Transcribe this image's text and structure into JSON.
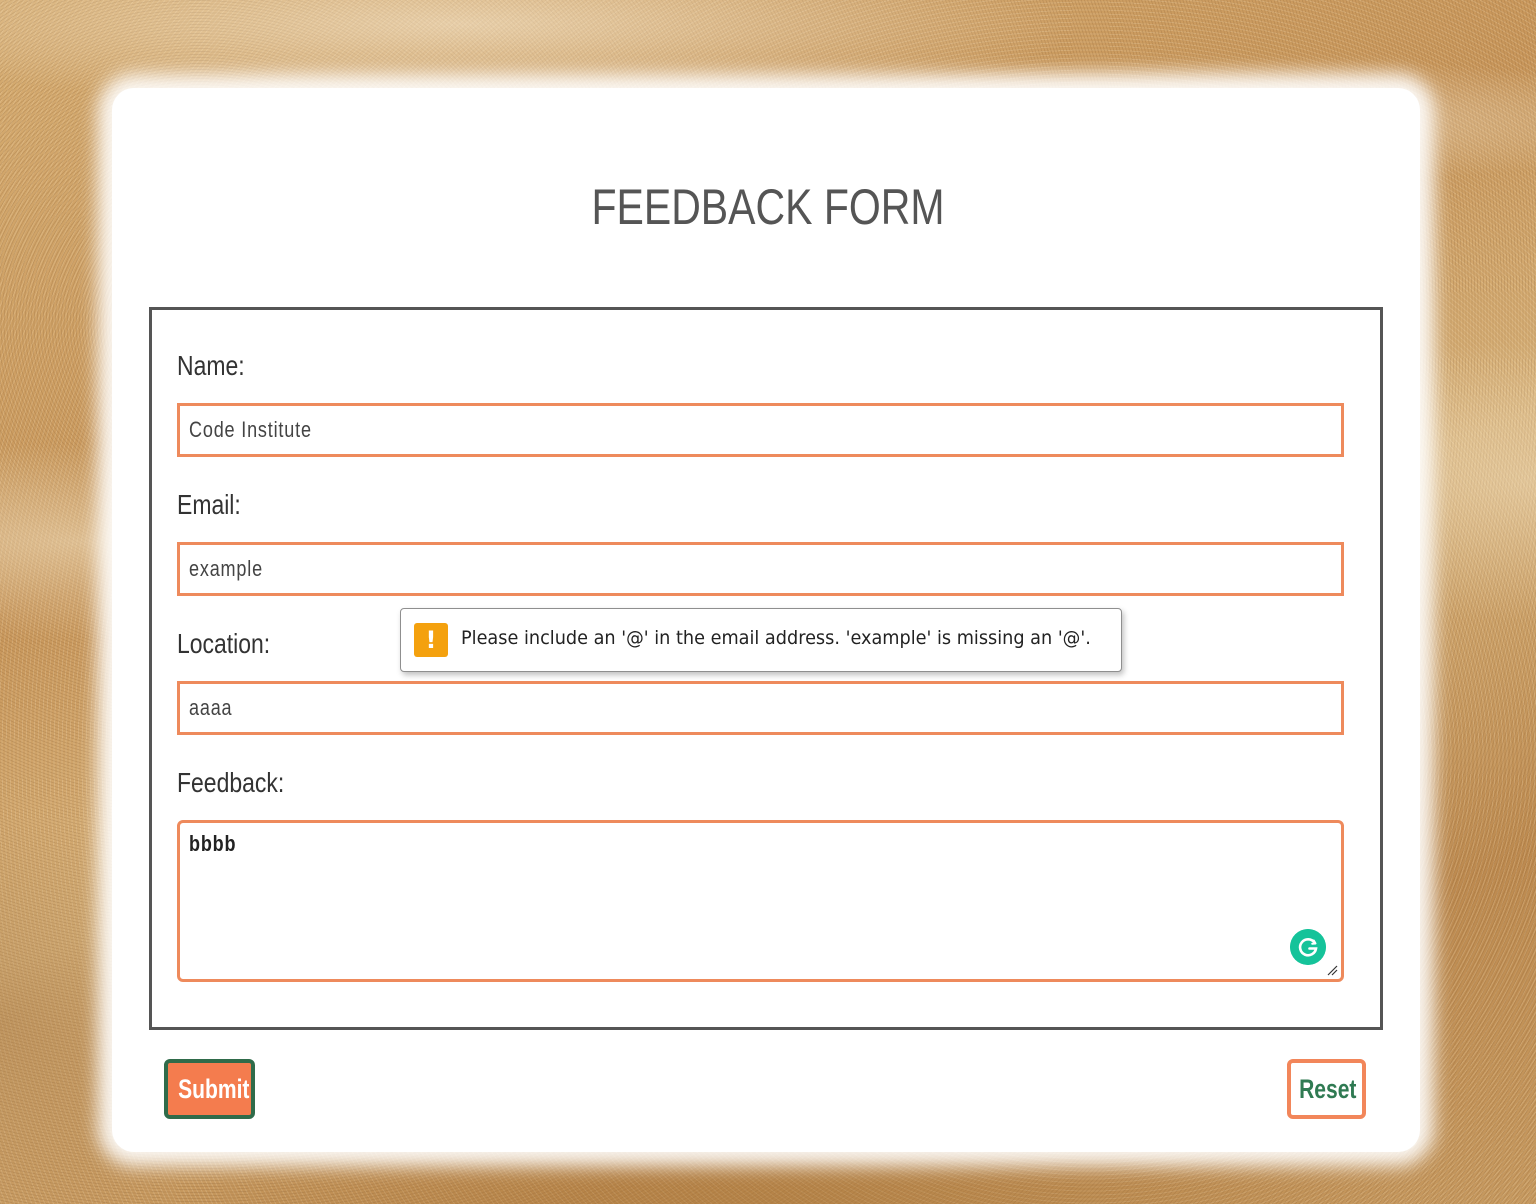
{
  "page": {
    "title": "FEEDBACK FORM"
  },
  "form": {
    "name": {
      "label": "Name:",
      "value": "Code Institute"
    },
    "email": {
      "label": "Email:",
      "value": "example"
    },
    "location": {
      "label": "Location:",
      "value": "aaaa"
    },
    "feedback": {
      "label": "Feedback:",
      "value": "bbbb"
    }
  },
  "validation_tooltip": {
    "icon": "warning-icon",
    "icon_glyph": "!",
    "message": "Please include an '@' in the email address. 'example' is missing an '@'."
  },
  "buttons": {
    "submit_label": "Submit",
    "reset_label": "Reset"
  },
  "extensions": {
    "grammarly_icon": "grammarly-icon"
  },
  "colors": {
    "input_border": "#ee8a5c",
    "submit_bg": "#f47c4e",
    "submit_border": "#2f6b4a",
    "reset_border": "#f2865a",
    "reset_text": "#2f7a52",
    "warning": "#f4a10e",
    "grammarly": "#15c39a"
  }
}
